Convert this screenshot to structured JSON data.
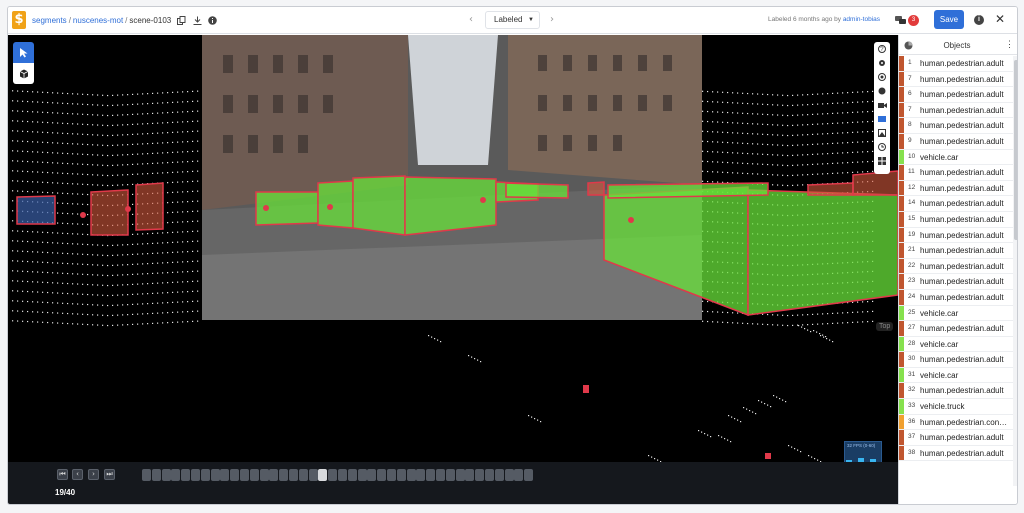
{
  "header": {
    "breadcrumb": {
      "root": "segments",
      "dataset": "nuscenes-mot",
      "scene": "scene-0103",
      "sep1": "/",
      "sep2": "/"
    },
    "status_select": "Labeled",
    "nav_prev": "‹",
    "nav_next": "›",
    "labeled_text": "Labeled 6 months ago by",
    "labeled_user": "admin-tobias",
    "issues_count": "3",
    "save_label": "Save",
    "info_label": "i",
    "close_label": "✕",
    "logo_text": "$"
  },
  "viewer": {
    "top_tag": "Top",
    "fps_label": "32 FPS (0-60)"
  },
  "timeline": {
    "first": "⏮",
    "prev": "‹",
    "next": "›",
    "last": "⏭",
    "current_frame": 19,
    "total_frames": 40,
    "counter": "19/40"
  },
  "panel": {
    "title": "Objects",
    "more": "⋮",
    "objects": [
      {
        "id": "1",
        "label": "human.pedestrian.adult",
        "color": "#c0562f"
      },
      {
        "id": "7",
        "label": "human.pedestrian.adult",
        "color": "#c0562f"
      },
      {
        "id": "6",
        "label": "human.pedestrian.adult",
        "color": "#c0562f"
      },
      {
        "id": "7",
        "label": "human.pedestrian.adult",
        "color": "#c0562f"
      },
      {
        "id": "8",
        "label": "human.pedestrian.adult",
        "color": "#c0562f"
      },
      {
        "id": "9",
        "label": "human.pedestrian.adult",
        "color": "#c0562f"
      },
      {
        "id": "10",
        "label": "vehicle.car",
        "color": "#86e14e"
      },
      {
        "id": "11",
        "label": "human.pedestrian.adult",
        "color": "#c0562f"
      },
      {
        "id": "12",
        "label": "human.pedestrian.adult",
        "color": "#c0562f"
      },
      {
        "id": "14",
        "label": "human.pedestrian.adult",
        "color": "#c0562f"
      },
      {
        "id": "15",
        "label": "human.pedestrian.adult",
        "color": "#c0562f"
      },
      {
        "id": "19",
        "label": "human.pedestrian.adult",
        "color": "#c0562f"
      },
      {
        "id": "21",
        "label": "human.pedestrian.adult",
        "color": "#c0562f"
      },
      {
        "id": "22",
        "label": "human.pedestrian.adult",
        "color": "#c0562f"
      },
      {
        "id": "23",
        "label": "human.pedestrian.adult",
        "color": "#c0562f"
      },
      {
        "id": "24",
        "label": "human.pedestrian.adult",
        "color": "#c0562f"
      },
      {
        "id": "25",
        "label": "vehicle.car",
        "color": "#86e14e"
      },
      {
        "id": "27",
        "label": "human.pedestrian.adult",
        "color": "#c0562f"
      },
      {
        "id": "28",
        "label": "vehicle.car",
        "color": "#86e14e"
      },
      {
        "id": "30",
        "label": "human.pedestrian.adult",
        "color": "#c0562f"
      },
      {
        "id": "31",
        "label": "vehicle.car",
        "color": "#86e14e"
      },
      {
        "id": "32",
        "label": "human.pedestrian.adult",
        "color": "#c0562f"
      },
      {
        "id": "33",
        "label": "vehicle.truck",
        "color": "#86e14e"
      },
      {
        "id": "36",
        "label": "human.pedestrian.construction_worker",
        "color": "#f0a030"
      },
      {
        "id": "37",
        "label": "human.pedestrian.adult",
        "color": "#c0562f"
      },
      {
        "id": "38",
        "label": "human.pedestrian.adult",
        "color": "#c0562f"
      }
    ]
  },
  "colors": {
    "accent": "#2f6fd8",
    "vehicle": "#86e14e",
    "pedestrian": "#c0562f",
    "box_outline": "#e0394a"
  }
}
